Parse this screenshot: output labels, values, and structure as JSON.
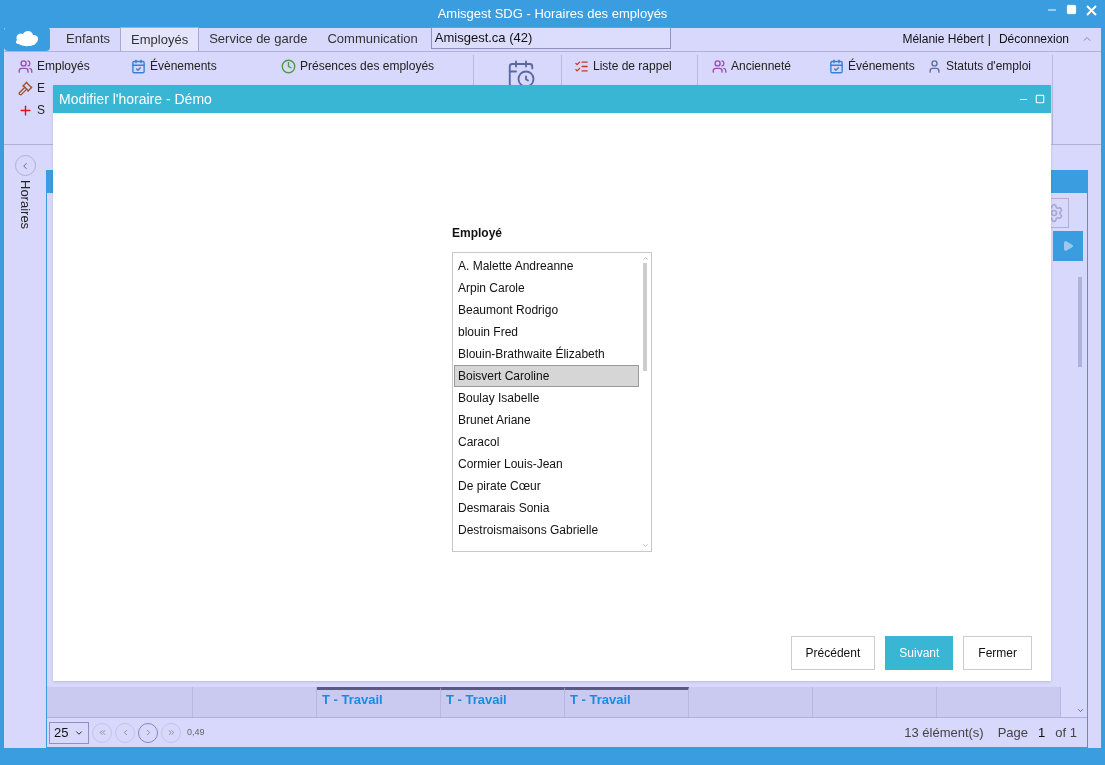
{
  "window": {
    "title": "Amisgest SDG - Horaires des employés"
  },
  "tabs": [
    {
      "label": "Enfants",
      "selected": false
    },
    {
      "label": "Employés",
      "selected": true
    },
    {
      "label": "Service de garde",
      "selected": false
    },
    {
      "label": "Communication",
      "selected": false
    }
  ],
  "notification": "Amisgest.ca (42)",
  "user": {
    "name": "Mélanie Hébert",
    "separator": "|",
    "logout": "Déconnexion"
  },
  "ribbon": [
    {
      "items": [
        {
          "label": "Employés",
          "kind": "people"
        },
        {
          "label": "E",
          "kind": "gavel"
        },
        {
          "label": "S",
          "kind": "cross"
        }
      ]
    },
    {
      "items": [
        {
          "label": "Évènements",
          "kind": "events"
        }
      ]
    },
    {
      "items": [
        {
          "label": "Présences des employés",
          "kind": "clock"
        }
      ]
    },
    {
      "items": [
        {
          "kind": "calendar"
        }
      ]
    },
    {
      "items": [
        {
          "label": "Liste de rappel",
          "kind": "list"
        }
      ]
    },
    {
      "items": [
        {
          "label": "Ancienneté",
          "kind": "people"
        }
      ]
    },
    {
      "items": [
        {
          "label": "Événements",
          "kind": "events"
        }
      ]
    },
    {
      "items": [
        {
          "label": "Statuts d'emploi",
          "kind": "person"
        }
      ]
    }
  ],
  "side_panel": {
    "label": "Horaires"
  },
  "grid": {
    "bottom_row": [
      {
        "label": "T - Travail"
      },
      {
        "label": "T - Travail"
      },
      {
        "label": "T - Travail"
      }
    ]
  },
  "pager": {
    "page_size": "25",
    "zoom": "0,49",
    "count": "13 élément(s)",
    "page_label": "Page",
    "page": "1",
    "of": "of 1"
  },
  "dialog": {
    "title": "Modifier l'horaire - Démo",
    "field_label": "Employé",
    "employees": [
      {
        "name": "A. Malette Andreanne",
        "selected": false
      },
      {
        "name": "Arpin Carole",
        "selected": false
      },
      {
        "name": "Beaumont Rodrigo",
        "selected": false
      },
      {
        "name": "blouin Fred",
        "selected": false
      },
      {
        "name": "Blouin-Brathwaite Élizabeth",
        "selected": false
      },
      {
        "name": "Boisvert Caroline",
        "selected": true
      },
      {
        "name": "Boulay Isabelle",
        "selected": false
      },
      {
        "name": "Brunet Ariane",
        "selected": false
      },
      {
        "name": "Caracol",
        "selected": false
      },
      {
        "name": "Cormier Louis-Jean",
        "selected": false
      },
      {
        "name": "De pirate Cœur",
        "selected": false
      },
      {
        "name": "Desmarais Sonia",
        "selected": false
      },
      {
        "name": "Destroismaisons Gabrielle",
        "selected": false
      }
    ],
    "buttons": [
      {
        "label": "Précédent",
        "kind": "secondary"
      },
      {
        "label": "Suivant",
        "kind": "primary"
      },
      {
        "label": "Fermer",
        "kind": "secondary"
      }
    ]
  }
}
